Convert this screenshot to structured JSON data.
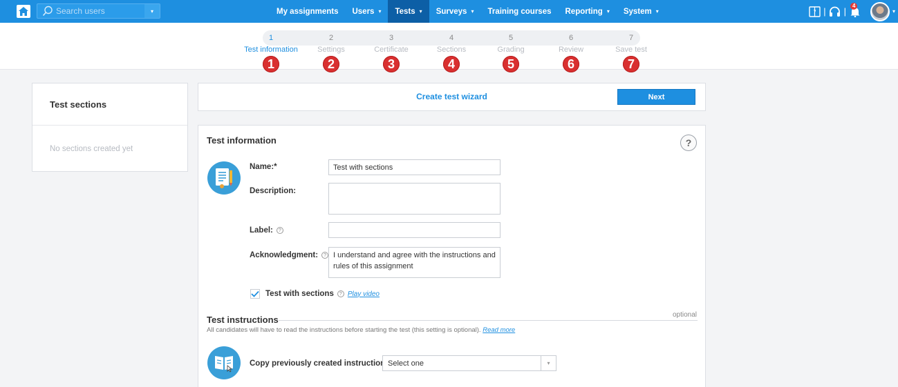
{
  "navbar": {
    "search_placeholder": "Search users",
    "menu": [
      {
        "label": "My assignments",
        "dropdown": false
      },
      {
        "label": "Users",
        "dropdown": true
      },
      {
        "label": "Tests",
        "dropdown": true,
        "active": true
      },
      {
        "label": "Surveys",
        "dropdown": true
      },
      {
        "label": "Training courses",
        "dropdown": false
      },
      {
        "label": "Reporting",
        "dropdown": true
      },
      {
        "label": "System",
        "dropdown": true
      }
    ],
    "notification_count": "4",
    "separator": "|",
    "caret": "▾"
  },
  "wizard": {
    "steps": [
      {
        "num": "1",
        "label": "Test information",
        "marker": "1",
        "active": true
      },
      {
        "num": "2",
        "label": "Settings",
        "marker": "2"
      },
      {
        "num": "3",
        "label": "Certificate",
        "marker": "3"
      },
      {
        "num": "4",
        "label": "Sections",
        "marker": "4"
      },
      {
        "num": "5",
        "label": "Grading",
        "marker": "5"
      },
      {
        "num": "6",
        "label": "Review",
        "marker": "6"
      },
      {
        "num": "7",
        "label": "Save test",
        "marker": "7"
      }
    ],
    "title": "Create test wizard",
    "next_label": "Next"
  },
  "sections_panel": {
    "title": "Test sections",
    "empty_text": "No sections created yet"
  },
  "form": {
    "title": "Test information",
    "help": "?",
    "name_label": "Name:*",
    "name_value": "Test with sections",
    "description_label": "Description:",
    "description_value": "",
    "label_label": "Label:",
    "label_value": "",
    "ack_label": "Acknowledgment:",
    "ack_value": "I understand and agree with the instructions and rules of this assignment",
    "qmark": "?",
    "sections_checkbox_label": "Test with sections",
    "sections_checked": true,
    "play_video": "Play video"
  },
  "instructions": {
    "title": "Test instructions",
    "optional": "optional",
    "description": "All candidates will have to read the instructions before starting the test (this setting is optional).",
    "read_more": "Read more",
    "copy_label": "Copy previously created instructions:",
    "select_value": "Select one"
  },
  "colors": {
    "accent": "#1e8fe0",
    "nav_active": "#0d5fa6",
    "marker": "#d93030"
  }
}
